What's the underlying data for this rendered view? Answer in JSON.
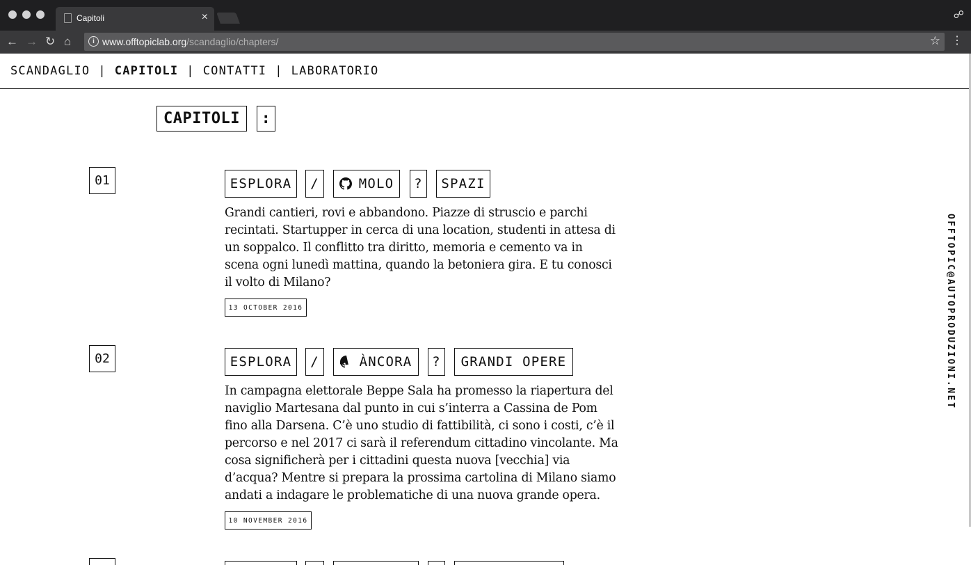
{
  "browser": {
    "tab_title": "Capitoli",
    "tab_close": "×",
    "url_host": "www.offtopiclab.org",
    "url_path": "/scandaglio/chapters/",
    "info_glyph": "i",
    "star_glyph": "☆",
    "menu_glyph": "⋮",
    "back_glyph": "←",
    "forward_glyph": "→",
    "reload_glyph": "↻",
    "home_glyph": "⌂",
    "incognito_glyph": "☍"
  },
  "nav": {
    "items": [
      "SCANDAGLIO",
      "CAPITOLI",
      "CONTATTI",
      "LABORATORIO"
    ],
    "separator": "|"
  },
  "page": {
    "heading": "CAPITOLI",
    "heading_suffix": ":"
  },
  "chapters": [
    {
      "number": "01",
      "action": "ESPLORA",
      "slash": "/",
      "project": "MOLO",
      "question": "?",
      "topic": "SPAZI",
      "description": "Grandi cantieri, rovi e abbandono. Piazze di struscio e parchi recintati. Startupper in cerca di una location, studenti in attesa di un soppalco. Il conflitto tra diritto, memoria e cemento va in scena ogni lunedì mattina, quando la betoniera gira. E tu conosci il volto di Milano?",
      "date": "13 OCTOBER 2016"
    },
    {
      "number": "02",
      "action": "ESPLORA",
      "slash": "/",
      "project": "ÀNCORA",
      "question": "?",
      "topic": "GRANDI OPERE",
      "description": "In campagna elettorale Beppe Sala ha promesso la riapertura del naviglio Martesana dal punto in cui s’interra a Cassina de Pom fino alla Darsena. C’è uno studio di fattibilità, ci sono i costi, c’è il percorso e nel 2017 ci sarà il referendum cittadino vincolante. Ma cosa significherà per i cittadini questa nuova [vecchia] via d’acqua? Mentre si prepara la prossima cartolina di Milano siamo andati a indagare le problematiche di una nuova grande opera.",
      "date": "10 NOVEMBER 2016"
    }
  ],
  "sidebar": {
    "email": "OFFTOPIC@AUTOPRODUZIONI.NET"
  }
}
